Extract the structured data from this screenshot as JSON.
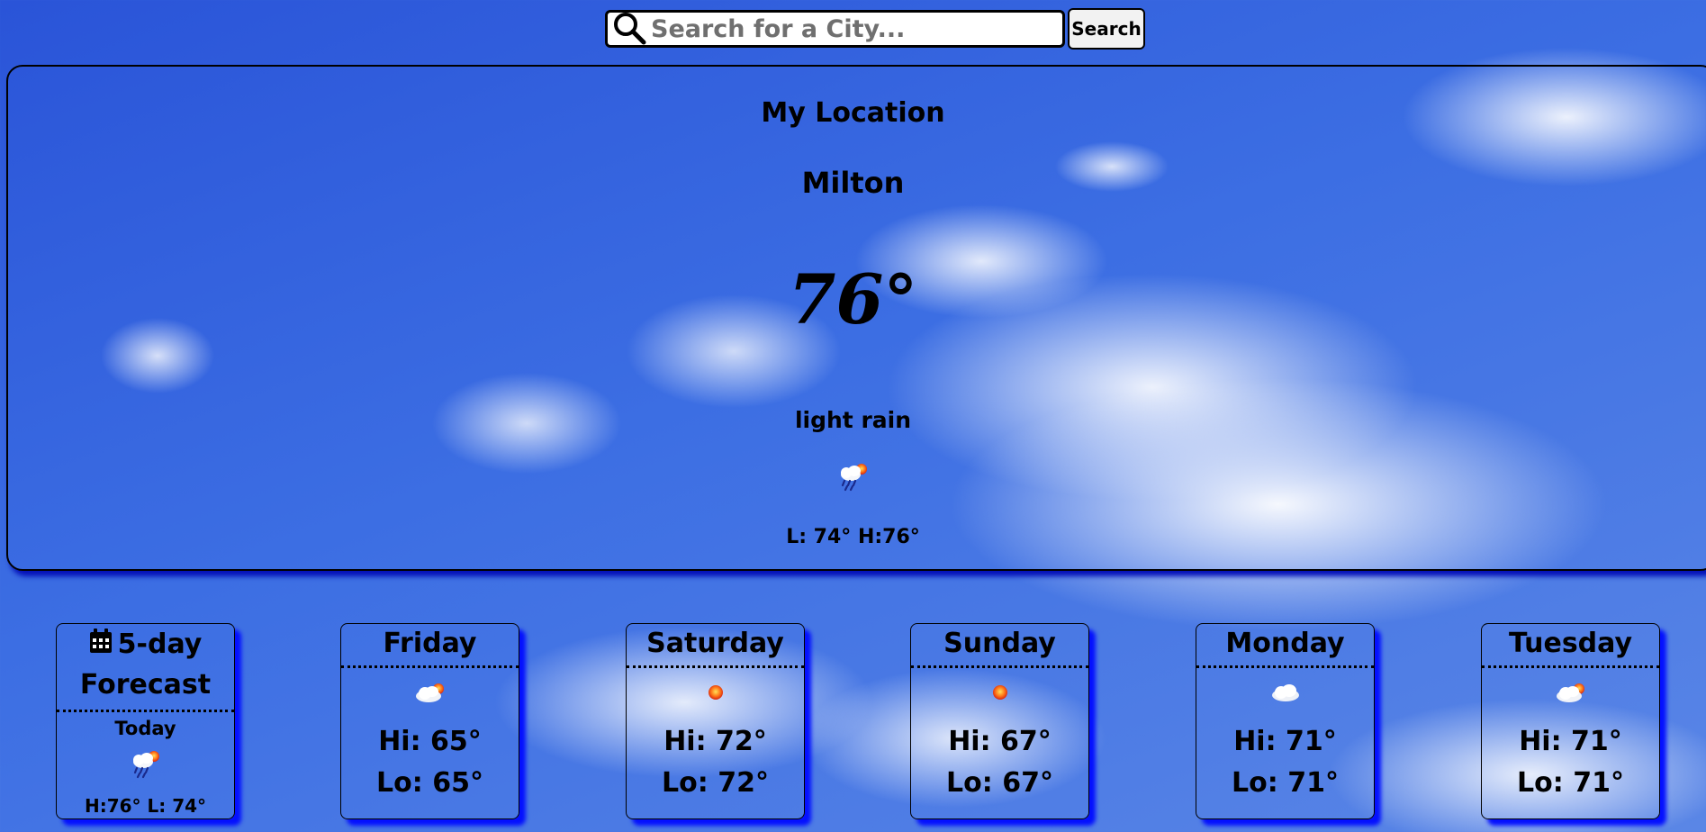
{
  "search": {
    "placeholder": "Search for a City...",
    "value": "",
    "button_label": "Search"
  },
  "current": {
    "heading": "My Location",
    "city": "Milton",
    "temperature": "76°",
    "description": "light rain",
    "icon": "sun-cloud-rain-icon",
    "low_high": "L: 74° H:76°"
  },
  "forecast": {
    "title_line1": "5-day",
    "title_line2": "Forecast",
    "title_icon": "calendar-icon",
    "today_label": "Today",
    "today_icon": "sun-cloud-rain-icon",
    "today_high_low": "H:76° L: 74°",
    "days": [
      {
        "name": "Friday",
        "icon": "cloud-sun-icon",
        "hi": "Hi: 65°",
        "lo": "Lo: 65°"
      },
      {
        "name": "Saturday",
        "icon": "sun-icon",
        "hi": "Hi: 72°",
        "lo": "Lo: 72°"
      },
      {
        "name": "Sunday",
        "icon": "sun-icon",
        "hi": "Hi: 67°",
        "lo": "Lo: 67°"
      },
      {
        "name": "Monday",
        "icon": "cloud-icon",
        "hi": "Hi: 71°",
        "lo": "Lo: 71°"
      },
      {
        "name": "Tuesday",
        "icon": "cloud-sun-icon",
        "hi": "Hi: 71°",
        "lo": "Lo: 71°"
      }
    ]
  },
  "colors": {
    "sky": "#3c6ee3",
    "shadow": "#0410ff",
    "sun": "#e8421a"
  }
}
